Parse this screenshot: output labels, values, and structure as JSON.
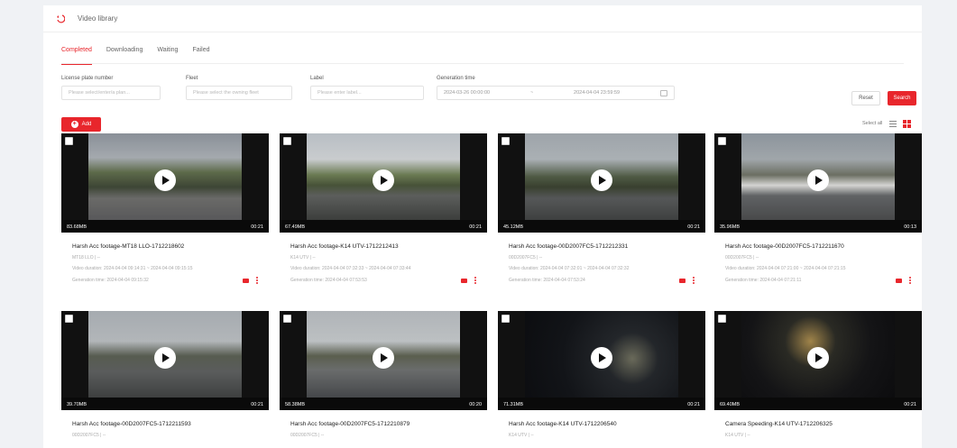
{
  "header": {
    "title": "Video library"
  },
  "tabs": [
    {
      "label": "Completed",
      "active": true
    },
    {
      "label": "Downloading",
      "active": false
    },
    {
      "label": "Waiting",
      "active": false
    },
    {
      "label": "Failed",
      "active": false
    }
  ],
  "filters": {
    "license_plate": {
      "label": "License plate number",
      "placeholder": "Please select/enter/a plan..."
    },
    "fleet": {
      "label": "Fleet",
      "placeholder": "Please select the owning fleet"
    },
    "label": {
      "label": "Label",
      "placeholder": "Please enter label..."
    },
    "generation_time": {
      "label": "Generation time",
      "start": "2024-03-26 00:00:00",
      "separator": "~",
      "end": "2024-04-04 23:59:59"
    }
  },
  "buttons": {
    "reset": "Reset",
    "search": "Search",
    "add": "Add",
    "select_all": "Select all"
  },
  "videos": [
    {
      "title": "Harsh Acc footage-MT18 LLO-1712218602",
      "vehicle": "MT18 LLO",
      "group": "--",
      "duration_label": "Video duration:",
      "duration_range": "2024-04-04 09:14:31 ~ 2024-04-04 09:15:15",
      "gen_label": "Generation time:",
      "gen_time": "2024-04-04 09:15:32",
      "size": "83.68MB",
      "length": "00:21"
    },
    {
      "title": "Harsh Acc footage-K14 UTV-1712212413",
      "vehicle": "K14 UTV",
      "group": "--",
      "duration_label": "Video duration:",
      "duration_range": "2024-04-04 07:32:33 ~ 2024-04-04 07:33:44",
      "gen_label": "Generation time:",
      "gen_time": "2024-04-04 07:53:53",
      "size": "67.49MB",
      "length": "00:21"
    },
    {
      "title": "Harsh Acc footage-00D2007FC5-1712212331",
      "vehicle": "00D2007FC5",
      "group": "--",
      "duration_label": "Video duration:",
      "duration_range": "2024-04-04 07:32:01 ~ 2024-04-04 07:32:32",
      "gen_label": "Generation time:",
      "gen_time": "2024-04-04 07:53:24",
      "size": "45.12MB",
      "length": "00:21"
    },
    {
      "title": "Harsh Acc footage-00D2007FC5-1712211670",
      "vehicle": "00D2007FC5",
      "group": "--",
      "duration_label": "Video duration:",
      "duration_range": "2024-04-04 07:21:00 ~ 2024-04-04 07:21:15",
      "gen_label": "Generation time:",
      "gen_time": "2024-04-04 07:21:11",
      "size": "35.96MB",
      "length": "00:13"
    },
    {
      "title": "Harsh Acc footage-00D2007FC5-1712211593",
      "vehicle": "00D2007FC5",
      "group": "--",
      "size": "39.70MB",
      "length": "00:21"
    },
    {
      "title": "Harsh Acc footage-00D2007FC5-1712210879",
      "vehicle": "00D2007FC5",
      "group": "--",
      "size": "58.38MB",
      "length": "00:20"
    },
    {
      "title": "Harsh Acc footage-K14 UTV-1712206540",
      "vehicle": "K14 UTV",
      "group": "--",
      "size": "71.31MB",
      "length": "00:21"
    },
    {
      "title": "Camera Speeding-K14 UTV-1712206325",
      "vehicle": "K14 UTV",
      "group": "--",
      "size": "69.40MB",
      "length": "00:21"
    }
  ],
  "colors": {
    "accent": "#e8262c"
  }
}
